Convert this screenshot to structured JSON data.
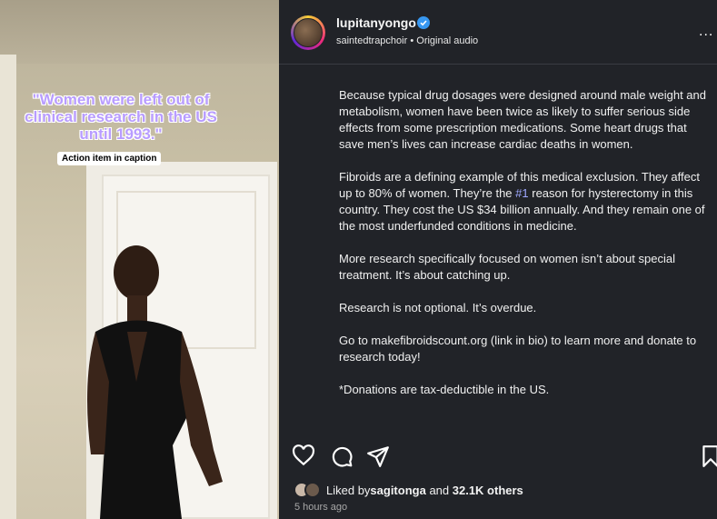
{
  "video": {
    "caption_overlay": "\"Women were left out of clinical research in the US until 1993.\"",
    "action_pill": "Action item in caption"
  },
  "header": {
    "username": "lupitanyongo",
    "audio_owner": "saintedtrapchoir",
    "separator": "•",
    "audio_label": "Original audio",
    "more_glyph": "..."
  },
  "caption": {
    "paragraphs": [
      "Because typical drug dosages were designed around male weight and metabolism, women have been twice as likely to suffer serious side effects from some prescription medications. Some heart drugs that save men’s lives can increase cardiac deaths in women.",
      "More research specifically focused on women isn’t about special treatment. It’s about catching up.",
      "Research is not optional. It’s overdue.",
      "Go to makefibroidscount.org (link in bio) to learn more and donate to research today!",
      "*Donations are tax-deductible in the US."
    ],
    "fibroids_before": "Fibroids are a defining example of this medical exclusion. They affect up to 80% of women. They’re the ",
    "fibroids_hashtag": "#1",
    "fibroids_after": " reason for hysterectomy in this country. They cost the US $34 billion annually. And they remain one of the most underfunded conditions in medicine."
  },
  "likes": {
    "prefix": "Liked by ",
    "user": "sagitonga",
    "middle": " and ",
    "count": "32.1K others"
  },
  "timestamp": "5 hours ago",
  "colors": {
    "panel_bg": "#212328",
    "hashtag": "#9fa8ff",
    "verified": "#3797f0"
  }
}
